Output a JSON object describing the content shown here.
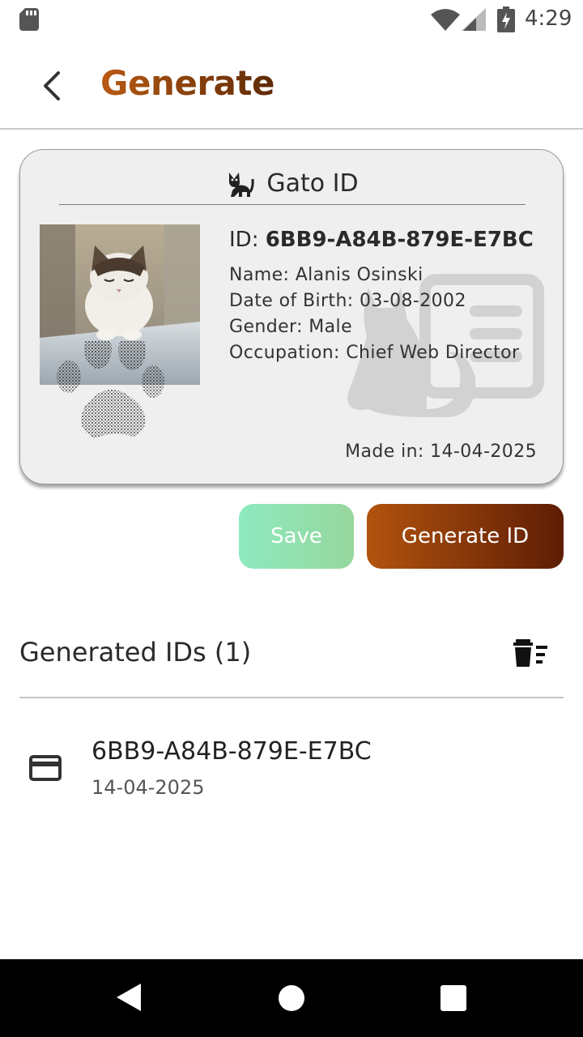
{
  "status_bar": {
    "time": "4:29"
  },
  "app_bar": {
    "title": "Generate"
  },
  "card": {
    "title": "Gato ID",
    "id_label": "ID:",
    "id_value": "6BB9-A84B-879E-E7BC",
    "name": "Name: Alanis Osinski",
    "dob": "Date of Birth: 03-08-2002",
    "gender": "Gender: Male",
    "occupation": "Occupation: Chief Web Director",
    "made_in": "Made in: 14-04-2025"
  },
  "actions": {
    "save_label": "Save",
    "generate_label": "Generate ID"
  },
  "generated": {
    "title": "Generated IDs (1)",
    "items": [
      {
        "id": "6BB9-A84B-879E-E7BC",
        "date": "14-04-2025"
      }
    ]
  },
  "colors": {
    "title_gradient": [
      "#b85a14",
      "#5e2a06"
    ],
    "save_gradient": [
      "#8eeac0",
      "#96d79c"
    ],
    "generate_gradient": [
      "#b2530f",
      "#5e1d04"
    ]
  },
  "icons": {
    "status": [
      "sd-card-icon",
      "wifi-icon",
      "signal-icon",
      "battery-charging-icon"
    ],
    "app_bar": "back-arrow-icon",
    "card": [
      "cat-icon",
      "id-card-watermark-icon",
      "paw-print-icon"
    ],
    "list": [
      "delete-sweep-icon",
      "credit-card-icon"
    ],
    "nav": [
      "nav-back-icon",
      "nav-home-icon",
      "nav-recents-icon"
    ]
  }
}
